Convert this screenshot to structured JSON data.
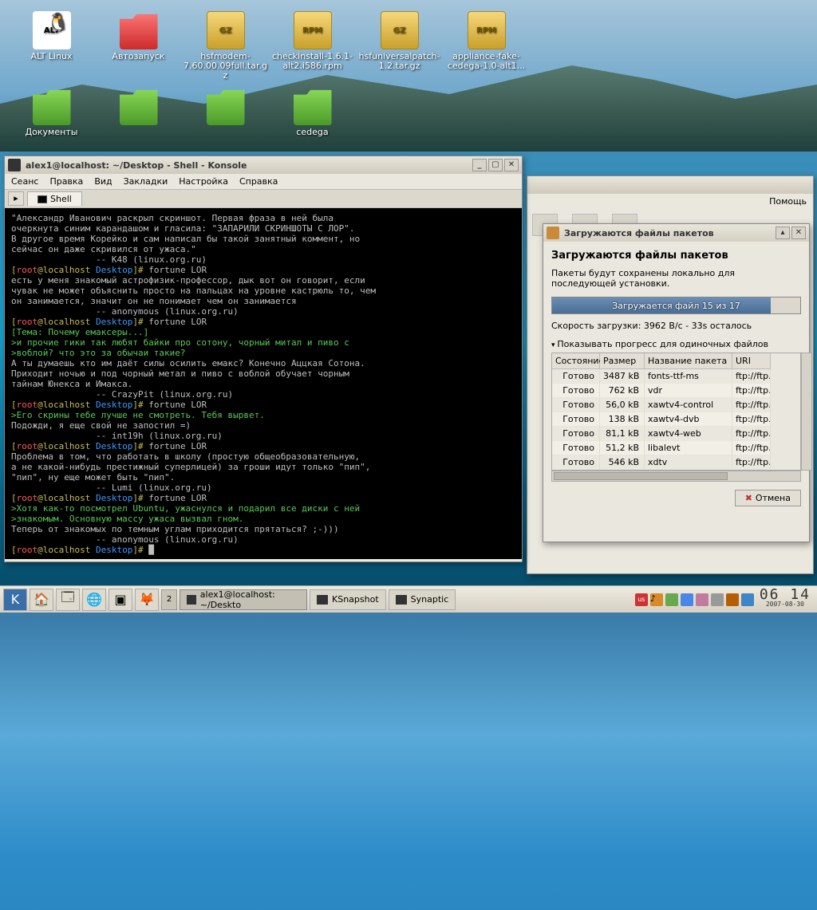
{
  "desktop_icons": [
    {
      "label": "ALT Linux",
      "glyph": "logo",
      "glyphText": "ALT"
    },
    {
      "label": "Автозапуск",
      "glyph": "folder-red"
    },
    {
      "label": "hsfmodem-7.60.00.09full.tar.gz",
      "glyph": "pkg",
      "glyphText": "GZ"
    },
    {
      "label": "checkinstall-1.6.1-alt2.i586.rpm",
      "glyph": "pkg",
      "glyphText": "RPM"
    },
    {
      "label": "hsfuniversalpatch-1.2.tar.gz",
      "glyph": "pkg",
      "glyphText": "GZ"
    },
    {
      "label": "appliance-fake-cedega-1.0-alt1...",
      "glyph": "pkg",
      "glyphText": "RPM"
    },
    {
      "label": "Документы",
      "glyph": "folder-green"
    },
    {
      "label": "",
      "glyph": "folder-green"
    },
    {
      "label": "",
      "glyph": "folder-green"
    },
    {
      "label": "cedega",
      "glyph": "folder-green"
    }
  ],
  "konsole": {
    "title": "alex1@localhost: ~/Desktop - Shell - Konsole",
    "menu": [
      "Сеанс",
      "Правка",
      "Вид",
      "Закладки",
      "Настройка",
      "Справка"
    ],
    "tab": "Shell",
    "content": "\"Александр Иванович раскрыл скриншот. Первая фраза в ней была\nочеркнута синим карандашом и гласила: \"ЗАПАРИЛИ СКРИНШОТЫ С ЛОР\".\nВ другое время Корейко и сам написал бы такой занятный коммент, но\nсейчас он даже скривился от ужаса.\"\n                -- K48 (linux.org.ru)\n[root@localhost Desktop]# fortune LOR\nесть у меня знакомый астрофизик-профессор, дык вот он говорит, если\nчувак не может объяснить просто на пальцах на уровне кастрюль то, чем\nон занимается, значит он не понимает чем он занимается\n                -- anonymous (linux.org.ru)\n[root@localhost Desktop]# fortune LOR\n[Тема: Почему емаксеры...]\n>и прочие гики так любят байки про сотону, чорный митал и пиво с\n>воблой? что это за обычаи такие?\nА ты думаешь кто им даёт силы осилить емакс? Конечно Аццкая Сотона.\nПриходит ночью и под чорный метал и пиво с воблой обучает чорным\nтайнам Юнекса и Имакса.\n                -- CrazyPit (linux.org.ru)\n[root@localhost Desktop]# fortune LOR\n>Его скрины тебе лучше не смотреть. Тебя вырвет.\nПодожди, я еще свой не запостил =)\n                -- int19h (linux.org.ru)\n[root@localhost Desktop]# fortune LOR\nПроблема в том, что работать в школу (простую общеобразовательную,\nа не какой-нибудь престижный суперлицей) за гроши идут только \"пип\",\n\"пип\", ну еще может быть \"пип\".\n                -- Lumi (linux.org.ru)\n[root@localhost Desktop]# fortune LOR\n>Хотя как-то посмотрел Ubuntu, ужаснулся и подарил все диски с ней\n>знакомым. Основную массу ужаса вызвал гном.\nТеперь от знакомых по темным углам приходится прятаться? ;-)))\n                -- anonymous (linux.org.ru)\n[root@localhost Desktop]# █"
  },
  "bgwin": {
    "menu_last": "Помощь"
  },
  "dialog": {
    "title": "Загружаются файлы пакетов",
    "heading": "Загружаются файлы пакетов",
    "desc": "Пакеты будут сохранены локально для последующей установки.",
    "progress_text": "Загружается файл 15 из 17",
    "speed": "Скорость загрузки: 3962 B/c - 33s осталось",
    "disclose": "Показывать прогресс для одиночных файлов",
    "headers": [
      "Состояние",
      "Размер",
      "Название пакета",
      "URI"
    ],
    "rows": [
      {
        "state": "Готово",
        "size": "3487 kB",
        "name": "fonts-ttf-ms",
        "uri": "ftp://ftp.a"
      },
      {
        "state": "Готово",
        "size": "762 kB",
        "name": "vdr",
        "uri": "ftp://ftp.a"
      },
      {
        "state": "Готово",
        "size": "56,0 kB",
        "name": "xawtv4-control",
        "uri": "ftp://ftp.a"
      },
      {
        "state": "Готово",
        "size": "138 kB",
        "name": "xawtv4-dvb",
        "uri": "ftp://ftp.a"
      },
      {
        "state": "Готово",
        "size": "81,1 kB",
        "name": "xawtv4-web",
        "uri": "ftp://ftp.a"
      },
      {
        "state": "Готово",
        "size": "51,2 kB",
        "name": "libalevt",
        "uri": "ftp://ftp.a"
      },
      {
        "state": "Готово",
        "size": "546 kB",
        "name": "xdtv",
        "uri": "ftp://ftp.a"
      }
    ],
    "cancel": "Отмена"
  },
  "taskbar": {
    "tasks": [
      {
        "label": "alex1@localhost: ~/Deskto",
        "active": true
      },
      {
        "label": "KSnapshot",
        "active": false
      },
      {
        "label": "Synaptic",
        "active": false
      }
    ],
    "pager": "2",
    "lang": "us",
    "clock_time": "06 14",
    "clock_date": "2007-08-30"
  }
}
